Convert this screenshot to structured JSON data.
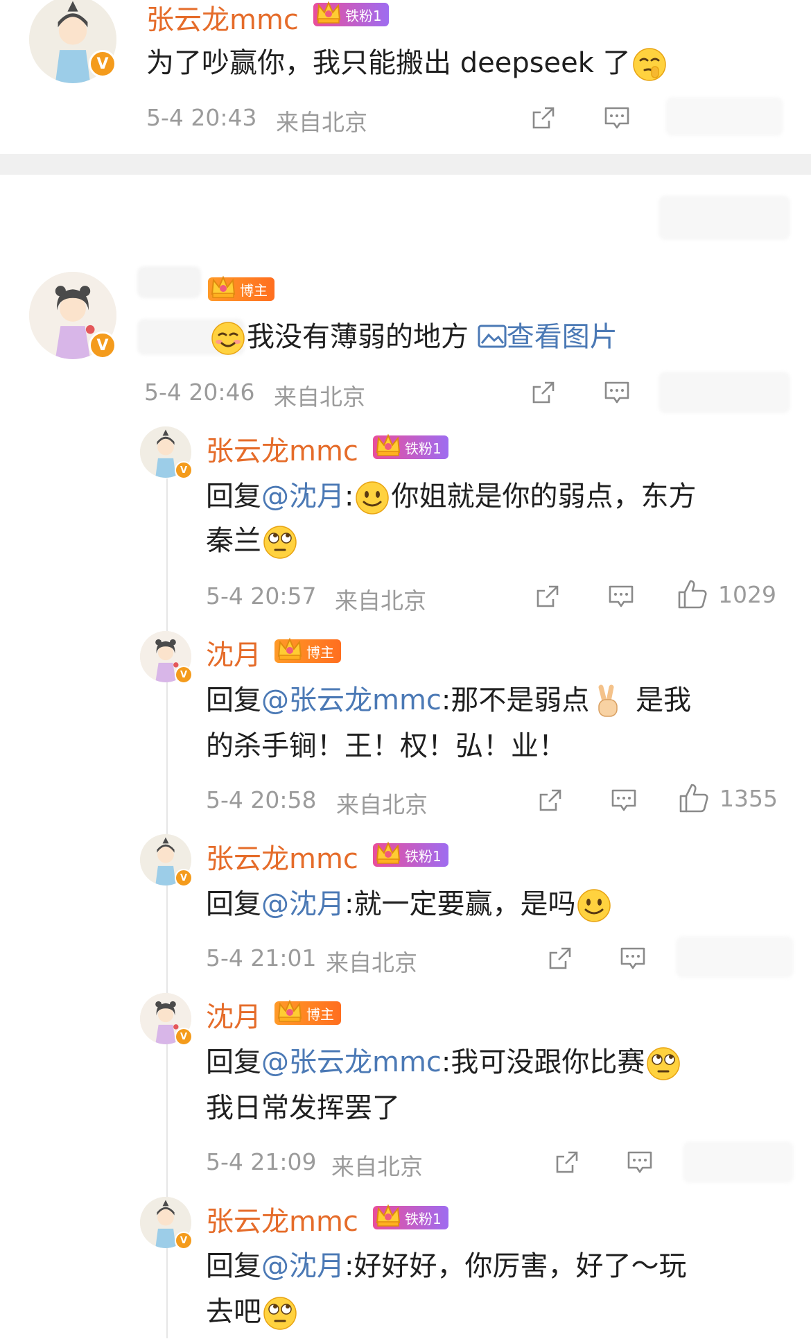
{
  "top": {
    "name": "张云龙mmc",
    "badge": "铁粉1",
    "text": "为了吵赢你，我只能搬出 deepseek 了",
    "time": "5-4 20:43",
    "location": "来自北京"
  },
  "main_comment": {
    "badge": "博主",
    "text": "我没有薄弱的地方",
    "view_image": "查看图片",
    "time": "5-4 20:46",
    "location": "来自北京"
  },
  "replies": [
    {
      "name": "张云龙mmc",
      "badge": "铁粉1",
      "reply_prefix": "回复",
      "mention": "@沈月",
      "colon": ":",
      "line1": "你姐就是你的弱点，东方",
      "line2": "秦兰",
      "time": "5-4 20:57",
      "location": "来自北京",
      "likes": "1029"
    },
    {
      "name": "沈月",
      "badge": "博主",
      "reply_prefix": "回复",
      "mention": "@张云龙mmc",
      "colon": ":",
      "line1a": "那不是弱点",
      "line1b": "是我",
      "line2": "的杀手锏！王！权！弘！业！",
      "time": "5-4 20:58",
      "location": "来自北京",
      "likes": "1355"
    },
    {
      "name": "张云龙mmc",
      "badge": "铁粉1",
      "reply_prefix": "回复",
      "mention": "@沈月",
      "colon": ":",
      "line1": "就一定要赢，是吗",
      "time": "5-4 21:01",
      "location": "来自北京"
    },
    {
      "name": "沈月",
      "badge": "博主",
      "reply_prefix": "回复",
      "mention": "@张云龙mmc",
      "colon": ":",
      "line1": "我可没跟你比赛",
      "line2": "我日常发挥罢了",
      "time": "5-4 21:09",
      "location": "来自北京"
    },
    {
      "name": "张云龙mmc",
      "badge": "铁粉1",
      "reply_prefix": "回复",
      "mention": "@沈月",
      "colon": ":",
      "line1": "好好好，你厉害，好了～玩",
      "line2": "去吧"
    }
  ],
  "verified_mark": "V",
  "colors": {
    "username": "#e56c2a",
    "mention": "#4b79b5",
    "meta": "#9b9b9b",
    "verified": "#f49b1c"
  }
}
